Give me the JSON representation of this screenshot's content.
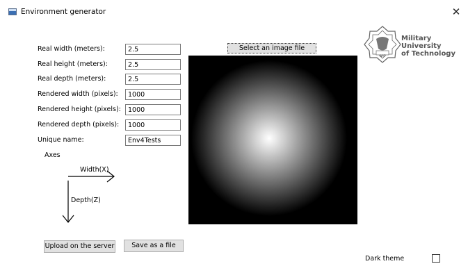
{
  "window": {
    "title": "Environment generator",
    "close_glyph": "✕"
  },
  "form": {
    "fields": [
      {
        "label": "Real width (meters):",
        "value": "2.5"
      },
      {
        "label": "Real height (meters):",
        "value": "2.5"
      },
      {
        "label": "Real depth (meters):",
        "value": "2.5"
      },
      {
        "label": "Rendered width (pixels):",
        "value": "1000"
      },
      {
        "label": "Rendered height (pixels):",
        "value": "1000"
      },
      {
        "label": "Rendered depth (pixels):",
        "value": "1000"
      },
      {
        "label": "Unique name:",
        "value": "Env4Tests"
      }
    ]
  },
  "axes": {
    "title": "Axes",
    "width_label": "Width(X)",
    "depth_label": "Depth(Z)"
  },
  "image": {
    "select_button": "Select an image file"
  },
  "logo": {
    "line1": "Military",
    "line2": "University",
    "line3": "of Technology",
    "emblem_text": "WAT"
  },
  "buttons": {
    "upload": "Upload on the server",
    "save": "Save as a file"
  },
  "theme": {
    "label": "Dark theme",
    "checked": false
  },
  "icons": {
    "app": "window-app-icon",
    "close": "close-icon"
  }
}
